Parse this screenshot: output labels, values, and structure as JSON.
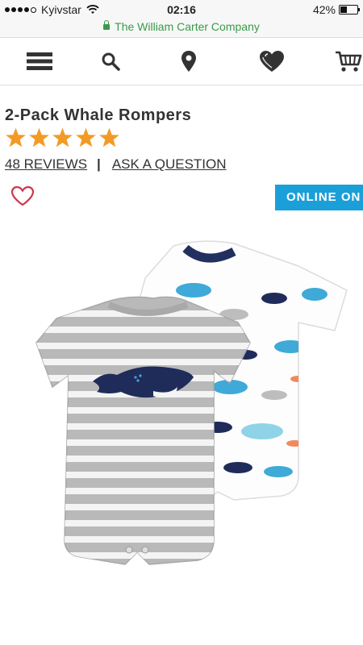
{
  "status_bar": {
    "carrier": "Kyivstar",
    "time": "02:16",
    "battery_percent": "42%",
    "battery_level": 0.42
  },
  "url_bar": {
    "site": "The William Carter Company",
    "secure": true
  },
  "nav": {
    "icons": [
      "menu-icon",
      "search-icon",
      "location-icon",
      "heart-icon",
      "cart-icon"
    ]
  },
  "product": {
    "title": "2-Pack Whale Rompers",
    "rating": 5,
    "reviews_link": "48 REVIEWS",
    "separator": "|",
    "ask_link": "ASK A QUESTION",
    "availability_badge": "ONLINE ON"
  },
  "colors": {
    "star": "#f39a26",
    "badge": "#1b9fd9",
    "secure_green": "#3a9a4a",
    "favorite": "#d0364a"
  }
}
